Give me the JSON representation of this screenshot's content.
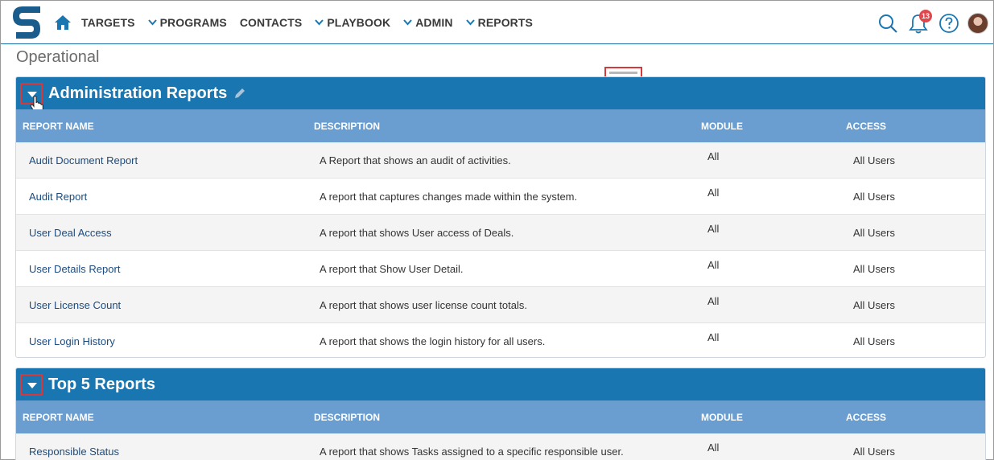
{
  "nav": {
    "items": [
      {
        "label": "TARGETS",
        "has_chevron": false
      },
      {
        "label": "PROGRAMS",
        "has_chevron": true
      },
      {
        "label": "CONTACTS",
        "has_chevron": false
      },
      {
        "label": "PLAYBOOK",
        "has_chevron": true
      },
      {
        "label": "ADMIN",
        "has_chevron": true
      },
      {
        "label": "REPORTS",
        "has_chevron": true
      }
    ],
    "notification_count": "13",
    "icons": [
      "home-icon",
      "search-icon",
      "bell-icon",
      "help-icon",
      "avatar"
    ]
  },
  "page": {
    "title": "Operational"
  },
  "columns": {
    "name": "REPORT NAME",
    "description": "DESCRIPTION",
    "module": "MODULE",
    "access": "ACCESS"
  },
  "sections": [
    {
      "title": "Administration Reports",
      "rows": [
        {
          "name": "Audit Document Report",
          "description": "A Report that shows an audit of activities.",
          "module": "All",
          "access": "All Users"
        },
        {
          "name": "Audit Report",
          "description": "A report that captures changes made within the system.",
          "module": "All",
          "access": "All Users"
        },
        {
          "name": "User Deal Access",
          "description": "A report that shows User access of Deals.",
          "module": "All",
          "access": "All Users"
        },
        {
          "name": "User Details Report",
          "description": "A report that Show User Detail.",
          "module": "All",
          "access": "All Users"
        },
        {
          "name": "User License Count",
          "description": "A report that shows user license count totals.",
          "module": "All",
          "access": "All Users"
        },
        {
          "name": "User Login History",
          "description": "A report that shows the login history for all users.",
          "module": "All",
          "access": "All Users"
        }
      ]
    },
    {
      "title": "Top 5 Reports",
      "rows": [
        {
          "name": "Responsible Status",
          "description": "A report that shows Tasks assigned to a specific responsible user.",
          "module": "All",
          "access": "All Users"
        }
      ]
    }
  ],
  "colors": {
    "panel_header": "#1a76b0",
    "column_header": "#6a9ed0",
    "link": "#1c4b7e",
    "highlight": "#d9383a",
    "badge": "#e0474c"
  }
}
